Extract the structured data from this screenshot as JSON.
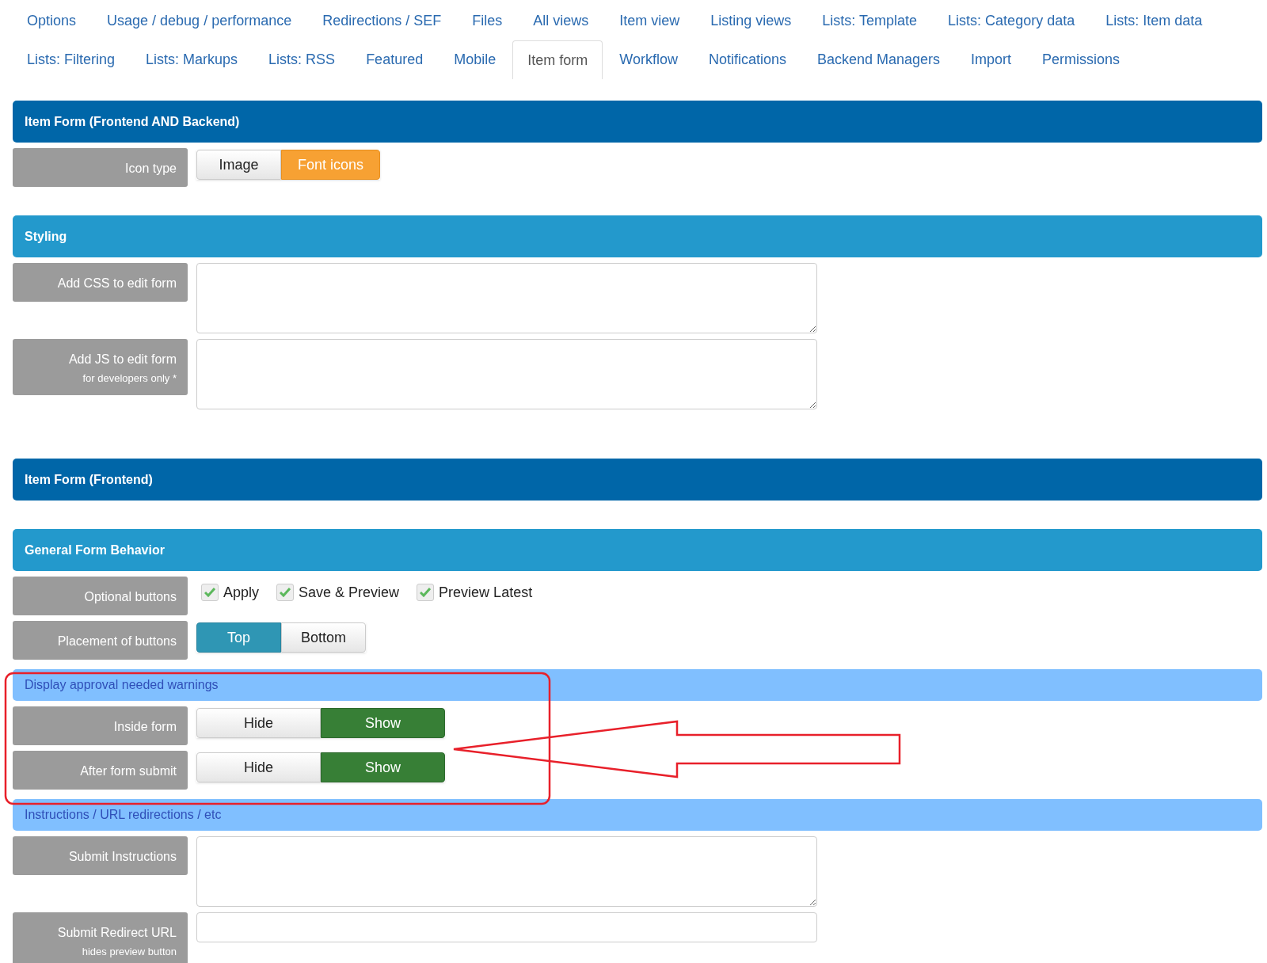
{
  "tabs": [
    {
      "label": "Options",
      "selected": false
    },
    {
      "label": "Usage / debug / performance",
      "selected": false
    },
    {
      "label": "Redirections / SEF",
      "selected": false
    },
    {
      "label": "Files",
      "selected": false
    },
    {
      "label": "All views",
      "selected": false
    },
    {
      "label": "Item view",
      "selected": false
    },
    {
      "label": "Listing views",
      "selected": false
    },
    {
      "label": "Lists: Template",
      "selected": false
    },
    {
      "label": "Lists: Category data",
      "selected": false
    },
    {
      "label": "Lists: Item data",
      "selected": false
    },
    {
      "label": "Lists: Filtering",
      "selected": false
    },
    {
      "label": "Lists: Markups",
      "selected": false
    },
    {
      "label": "Lists: RSS",
      "selected": false
    },
    {
      "label": "Featured",
      "selected": false
    },
    {
      "label": "Mobile",
      "selected": false
    },
    {
      "label": "Item form",
      "selected": true
    },
    {
      "label": "Workflow",
      "selected": false
    },
    {
      "label": "Notifications",
      "selected": false
    },
    {
      "label": "Backend Managers",
      "selected": false
    },
    {
      "label": "Import",
      "selected": false
    },
    {
      "label": "Permissions",
      "selected": false
    }
  ],
  "sections": [
    {
      "kind": "primary",
      "title": "Item Form (Frontend AND Backend)",
      "fields": [
        {
          "kind": "segmented",
          "label": "Icon type",
          "options": [
            {
              "label": "Image",
              "selected": false
            },
            {
              "label": "Font icons",
              "selected": true
            }
          ]
        }
      ]
    },
    {
      "kind": "secondary",
      "title": "Styling",
      "fields": [
        {
          "kind": "textarea",
          "label": "Add CSS to edit form"
        },
        {
          "kind": "textarea",
          "label": "Add JS to edit form",
          "note": "for developers only *"
        }
      ]
    },
    {
      "kind": "primary",
      "title": "Item Form (Frontend)"
    },
    {
      "kind": "secondary",
      "title": "General Form Behavior",
      "fields": [
        {
          "kind": "checkboxes",
          "label": "Optional buttons",
          "options": [
            {
              "label": "Apply",
              "checked": true
            },
            {
              "label": "Save & Preview",
              "checked": true
            },
            {
              "label": "Preview Latest",
              "checked": true
            }
          ]
        },
        {
          "kind": "segmented",
          "label": "Placement of buttons",
          "options": [
            {
              "label": "Top",
              "selected": true
            },
            {
              "label": "Bottom",
              "selected": false
            }
          ]
        }
      ]
    },
    {
      "kind": "subtle",
      "title": "Display approval needed warnings",
      "fields": [
        {
          "kind": "toggle",
          "label": "Inside form",
          "options": [
            {
              "label": "Hide",
              "selected": false
            },
            {
              "label": "Show",
              "selected": true
            }
          ]
        },
        {
          "kind": "toggle",
          "label": "After form submit",
          "options": [
            {
              "label": "Hide",
              "selected": false
            },
            {
              "label": "Show",
              "selected": true
            }
          ]
        }
      ]
    },
    {
      "kind": "subtle",
      "title": "Instructions / URL redirections / etc",
      "fields": [
        {
          "kind": "textarea",
          "label": "Submit Instructions"
        },
        {
          "kind": "input",
          "label": "Submit Redirect URL",
          "note": "hides preview button"
        }
      ]
    }
  ]
}
